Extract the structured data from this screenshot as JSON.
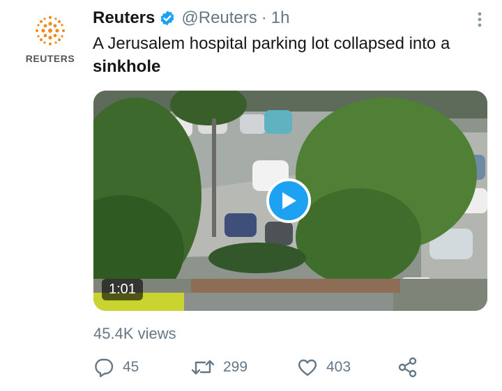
{
  "author": {
    "name": "Reuters",
    "handle": "@Reuters",
    "separator": "·",
    "time": "1h",
    "avatar_label": "REUTERS",
    "verified_icon": "verified-badge-icon",
    "menu_icon": "more-vertical-icon"
  },
  "tweet": {
    "text_before": "A Jerusalem hospital parking lot collapsed into a ",
    "text_bold": "sinkhole"
  },
  "media": {
    "duration": "1:01",
    "play_icon": "play-icon"
  },
  "stats": {
    "views": "45.4K views"
  },
  "actions": {
    "reply_count": "45",
    "retweet_count": "299",
    "like_count": "403",
    "reply_icon": "reply-icon",
    "retweet_icon": "retweet-icon",
    "like_icon": "heart-icon",
    "share_icon": "share-icon"
  },
  "colors": {
    "accent": "#1da1f2",
    "muted": "#657786",
    "brand": "#f08a24"
  }
}
